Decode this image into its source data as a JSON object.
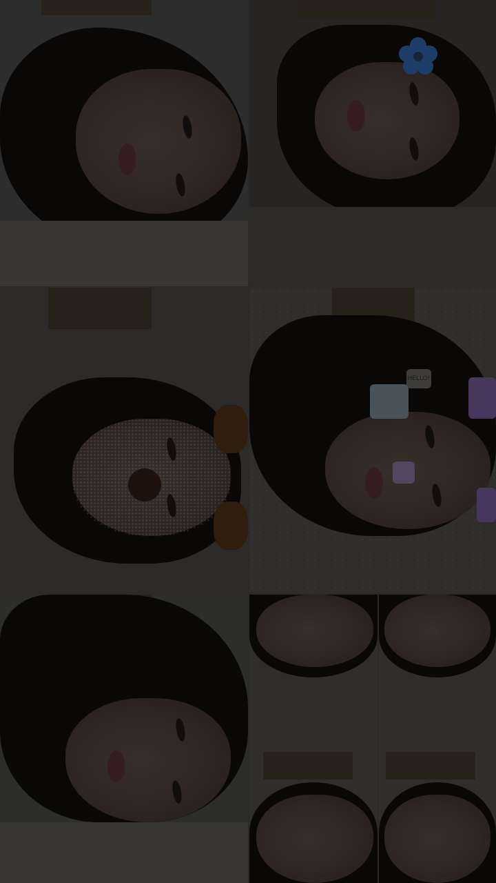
{
  "collage": {
    "tiles": [
      {
        "name": "selfie-tile-1",
        "filter": "none"
      },
      {
        "name": "selfie-tile-2",
        "filter": "flower-crown"
      },
      {
        "name": "selfie-tile-3",
        "filter": "puppy-nose-glitter"
      },
      {
        "name": "selfie-tile-4",
        "filter": "pixel-stickers"
      },
      {
        "name": "selfie-tile-5",
        "filter": "none"
      },
      {
        "name": "selfie-tile-6",
        "filter": "split-mirror"
      },
      {
        "name": "selfie-tile-7",
        "filter": "split-mirror"
      }
    ],
    "sticker_text": "HELLO!",
    "colors": {
      "overlay": "#000000",
      "flower": "#3a78c8",
      "sticker_purple": "#8a6ab0"
    }
  }
}
